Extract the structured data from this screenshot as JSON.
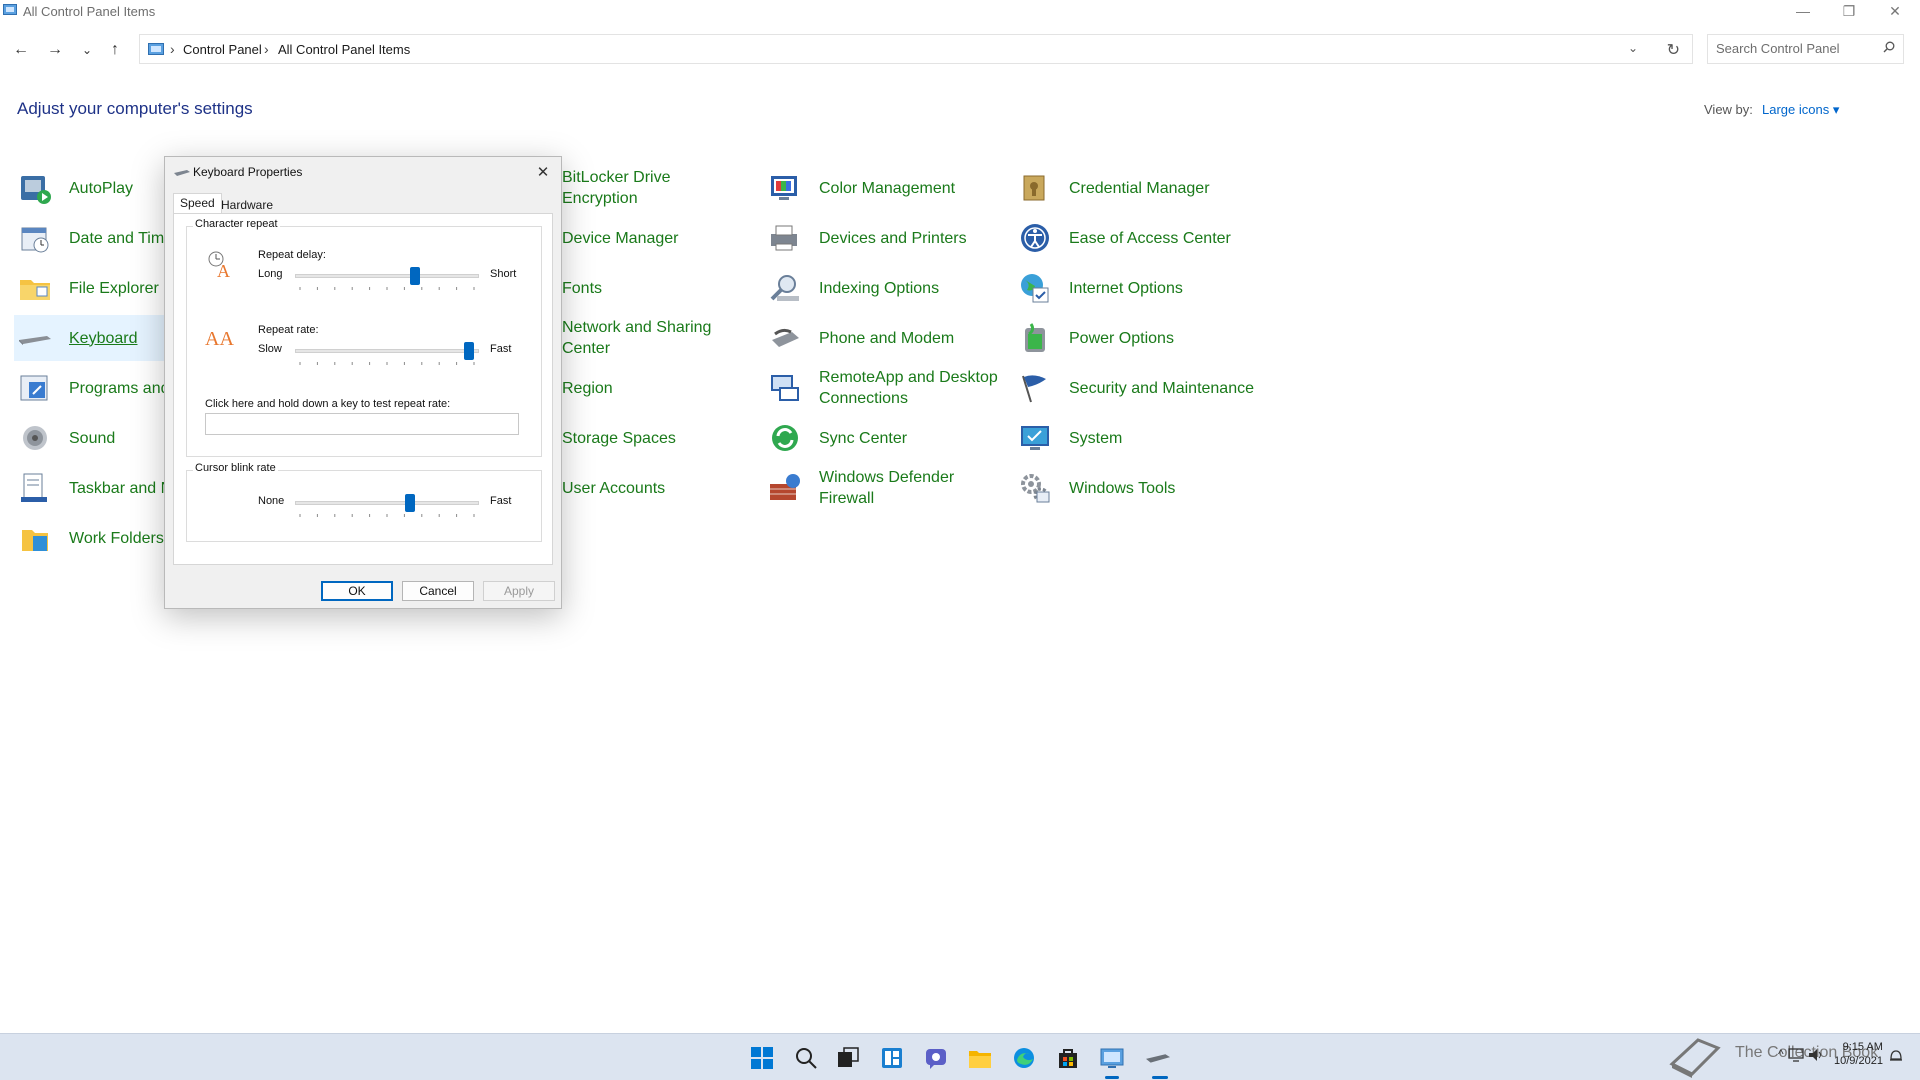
{
  "window": {
    "title": "All Control Panel Items",
    "minimize_glyph": "—",
    "restore_glyph": "❐",
    "close_glyph": "✕"
  },
  "address": {
    "back_glyph": "←",
    "forward_glyph": "→",
    "recent_glyph": "⌄",
    "up_glyph": "↑",
    "breadcrumbs": [
      "Control Panel",
      "All Control Panel Items"
    ],
    "separator": "›",
    "dropdown_glyph": "⌄",
    "refresh_glyph": "↻",
    "search_placeholder": "Search Control Panel"
  },
  "header": {
    "title": "Adjust your computer's settings",
    "view_by_label": "View by:",
    "view_by_value": "Large icons ▾"
  },
  "items": {
    "col1": [
      "AutoPlay",
      "Date and Time",
      "File Explorer O",
      "Keyboard",
      "Programs and",
      "Sound",
      "Taskbar and Na",
      "Work Folders"
    ],
    "col2": [
      "BitLocker Drive Encryption",
      "Device Manager",
      "Fonts",
      "Network and Sharing Center",
      "Region",
      "Storage Spaces",
      "User Accounts"
    ],
    "col3": [
      "Color Management",
      "Devices and Printers",
      "Indexing Options",
      "Phone and Modem",
      "RemoteApp and Desktop Connections",
      "Sync Center",
      "Windows Defender Firewall"
    ],
    "col4": [
      "Credential Manager",
      "Ease of Access Center",
      "Internet Options",
      "Power Options",
      "Security and Maintenance",
      "System",
      "Windows Tools"
    ],
    "selected": "Keyboard",
    "label_color": "#1a7a1a"
  },
  "dialog": {
    "title": "Keyboard Properties",
    "close_glyph": "✕",
    "tabs": [
      "Speed",
      "Hardware"
    ],
    "active_tab": "Speed",
    "character_repeat": {
      "group_label": "Character repeat",
      "repeat_delay": {
        "label": "Repeat delay:",
        "min_label": "Long",
        "max_label": "Short",
        "level": 0.66
      },
      "repeat_rate": {
        "label": "Repeat rate:",
        "min_label": "Slow",
        "max_label": "Fast",
        "level": 0.97
      },
      "test_label": "Click here and hold down a key to test repeat rate:",
      "test_value": ""
    },
    "cursor_blink": {
      "group_label": "Cursor blink rate",
      "min_label": "None",
      "max_label": "Fast",
      "level": 0.63
    },
    "buttons": {
      "ok": "OK",
      "cancel": "Cancel",
      "apply": "Apply"
    }
  },
  "taskbar": {
    "watermark": "The Collection Book",
    "clock_time": "9:15 AM",
    "clock_date": "10/9/2021",
    "accent": "#0067c0"
  }
}
